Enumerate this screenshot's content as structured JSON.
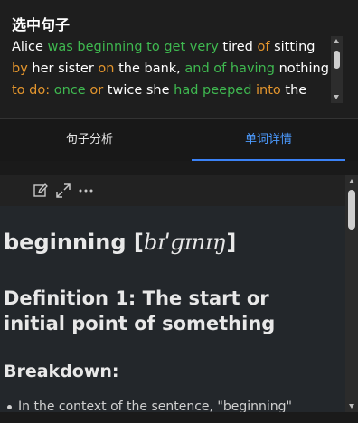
{
  "selected": {
    "title": "选中句子",
    "sentence_tokens": [
      {
        "text": "Alice ",
        "color": "white"
      },
      {
        "text": "was beginning to get very ",
        "color": "green"
      },
      {
        "text": "tired ",
        "color": "white"
      },
      {
        "text": "of ",
        "color": "orange"
      },
      {
        "text": "sitting ",
        "color": "white"
      },
      {
        "text": "by ",
        "color": "orange"
      },
      {
        "text": "her sister ",
        "color": "white"
      },
      {
        "text": "on ",
        "color": "orange"
      },
      {
        "text": "the bank, ",
        "color": "white"
      },
      {
        "text": "and of having ",
        "color": "green"
      },
      {
        "text": "nothing ",
        "color": "white"
      },
      {
        "text": "to do: ",
        "color": "orange"
      },
      {
        "text": "once ",
        "color": "green"
      },
      {
        "text": "or ",
        "color": "orange"
      },
      {
        "text": "twice she ",
        "color": "white"
      },
      {
        "text": "had peeped ",
        "color": "green"
      },
      {
        "text": "into ",
        "color": "orange"
      },
      {
        "text": "the book",
        "color": "white"
      }
    ]
  },
  "tabs": [
    {
      "label": "句子分析",
      "active": false
    },
    {
      "label": "单词详情",
      "active": true
    }
  ],
  "toolbar": {
    "icons": [
      "edit-icon",
      "expand-icon",
      "more-icon"
    ]
  },
  "detail": {
    "word": "beginning",
    "ipa": "bɪˈɡɪnɪŋ",
    "definition_heading": "Definition 1: The start or initial point of something",
    "breakdown_heading": "Breakdown:",
    "bullet_text": "In the context of the sentence, \"beginning\""
  },
  "colors": {
    "green": "#3fb950",
    "orange": "#e3952d",
    "white": "#ffffff",
    "accent": "#3b82f6"
  }
}
